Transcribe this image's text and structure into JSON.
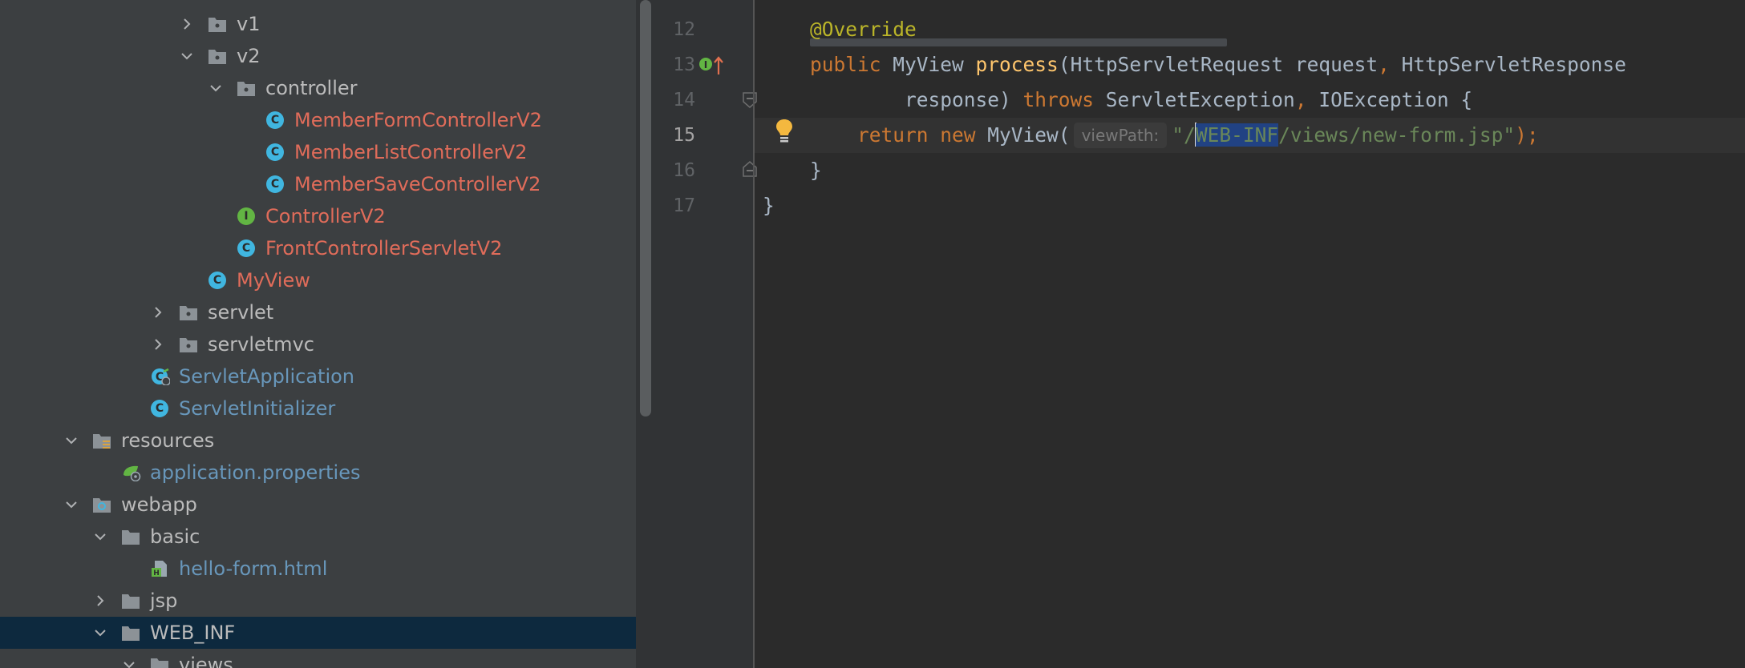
{
  "project_tree": {
    "items": [
      {
        "label": "v1",
        "kind": "package",
        "expanded": false
      },
      {
        "label": "v2",
        "kind": "package",
        "expanded": true
      },
      {
        "label": "controller",
        "kind": "package",
        "expanded": true
      },
      {
        "label": "MemberFormControllerV2",
        "kind": "class"
      },
      {
        "label": "MemberListControllerV2",
        "kind": "class"
      },
      {
        "label": "MemberSaveControllerV2",
        "kind": "class"
      },
      {
        "label": "ControllerV2",
        "kind": "interface"
      },
      {
        "label": "FrontControllerServletV2",
        "kind": "class"
      },
      {
        "label": "MyView",
        "kind": "class"
      },
      {
        "label": "servlet",
        "kind": "package",
        "expanded": false
      },
      {
        "label": "servletmvc",
        "kind": "package",
        "expanded": false
      },
      {
        "label": "ServletApplication",
        "kind": "spring-boot-class"
      },
      {
        "label": "ServletInitializer",
        "kind": "class"
      },
      {
        "label": "resources",
        "kind": "resources-folder",
        "expanded": true
      },
      {
        "label": "application.properties",
        "kind": "spring-properties"
      },
      {
        "label": "webapp",
        "kind": "web-folder",
        "expanded": true
      },
      {
        "label": "basic",
        "kind": "folder",
        "expanded": true
      },
      {
        "label": "hello-form.html",
        "kind": "html-file"
      },
      {
        "label": "jsp",
        "kind": "folder",
        "expanded": false
      },
      {
        "label": "WEB_INF",
        "kind": "folder",
        "expanded": true,
        "selected": true
      },
      {
        "label": "views",
        "kind": "folder",
        "expanded": true
      }
    ]
  },
  "editor": {
    "line_numbers": [
      "12",
      "13",
      "14",
      "15",
      "16",
      "17"
    ],
    "current_line": "15",
    "code": {
      "l12_annotation": "@Override",
      "l13_public": "public ",
      "l13_type": "MyView ",
      "l13_method": "process",
      "l13_params": "(HttpServletRequest request",
      "l13_comma": ", ",
      "l13_param2": "HttpServletResponse",
      "l14_param": "response) ",
      "l14_throws": "throws ",
      "l14_ex1": "ServletException",
      "l14_comma": ", ",
      "l14_ex2": "IOException {",
      "l15_return": "return ",
      "l15_new": "new ",
      "l15_call": "MyView(",
      "l15_hint": "viewPath:",
      "l15_str_a": "\"/",
      "l15_str_sel": "WEB-INF",
      "l15_str_b": "/views/new-form.jsp\"",
      "l15_end": ");",
      "l16_brace": "}",
      "l17_brace": "}"
    },
    "gutter_icons": {
      "line13": "implements-method-icon",
      "line14": "fold-icon",
      "line15": "intention-bulb-icon",
      "line16": "fold-icon"
    }
  }
}
